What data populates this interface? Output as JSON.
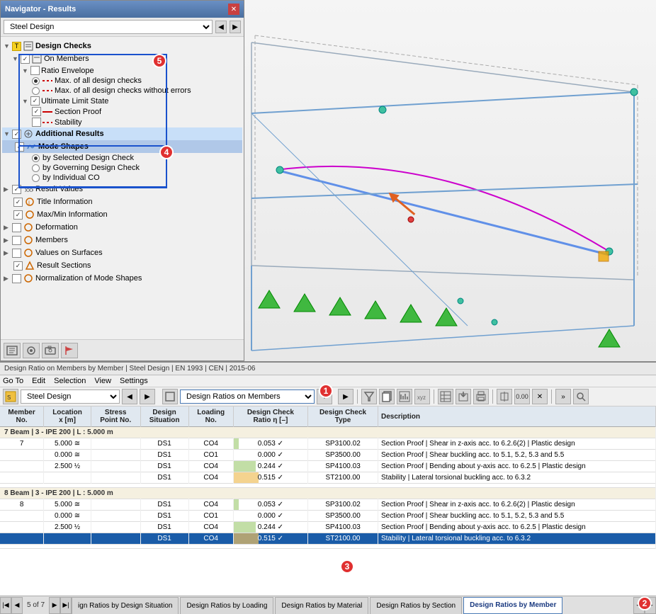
{
  "navigator": {
    "title": "Navigator - Results",
    "dropdown": "Steel Design",
    "tree": {
      "design_checks": "Design Checks",
      "on_members": "On Members",
      "ratio_envelope": "Ratio Envelope",
      "max_all": "Max. of all design checks",
      "max_all_no_errors": "Max. of all design checks without errors",
      "ultimate_limit": "Ultimate Limit State",
      "section_proof": "Section Proof",
      "stability": "Stability",
      "additional_results": "Additional Results",
      "mode_shapes": "Mode Shapes",
      "by_selected": "by Selected Design Check",
      "by_governing": "by Governing Design Check",
      "by_individual": "by Individual CO",
      "result_values": "Result Values",
      "title_info": "Title Information",
      "maxmin_info": "Max/Min Information",
      "deformation": "Deformation",
      "members": "Members",
      "values_on_surfaces": "Values on Surfaces",
      "result_sections": "Result Sections",
      "normalization": "Normalization of Mode Shapes"
    }
  },
  "results": {
    "title": "Design Ratio on Members by Member | Steel Design | EN 1993 | CEN | 2015-06",
    "menu": {
      "goto": "Go To",
      "edit": "Edit",
      "selection": "Selection",
      "view": "View",
      "settings": "Settings"
    },
    "toolbar": {
      "module_label": "Steel Design",
      "view_label": "Design Ratios on Members"
    },
    "table": {
      "headers": [
        "Member\nNo.",
        "Location\nx [m]",
        "Stress\nPoint No.",
        "Design\nSituation",
        "Loading\nNo.",
        "Design Check\nRatio η [–]",
        "Design Check\nType",
        "Description"
      ],
      "members": [
        {
          "id": 7,
          "label": "Beam | 3 - IPE 200 | L : 5.000 m",
          "rows": [
            {
              "location": "5.000",
              "loc_sym": "≅",
              "stress_pt": "",
              "situation": "DS1",
              "loading": "CO4",
              "ratio": 0.053,
              "ratio_pct": 10,
              "check_type": "SP3100.02",
              "description": "Section Proof | Shear in z-axis acc. to 6.2.6(2) | Plastic design",
              "ok": true
            },
            {
              "location": "0.000",
              "loc_sym": "≅",
              "stress_pt": "",
              "situation": "DS1",
              "loading": "CO1",
              "ratio": 0.0,
              "ratio_pct": 0,
              "check_type": "SP3500.00",
              "description": "Section Proof | Shear buckling acc. to 5.1, 5.2, 5.3 and 5.5",
              "ok": true
            },
            {
              "location": "2.500",
              "loc_sym": "½",
              "stress_pt": "",
              "situation": "DS1",
              "loading": "CO4",
              "ratio": 0.244,
              "ratio_pct": 44,
              "check_type": "SP4100.03",
              "description": "Section Proof | Bending about y-axis acc. to 6.2.5 | Plastic design",
              "ok": true
            },
            {
              "location": "",
              "loc_sym": "",
              "stress_pt": "",
              "situation": "DS1",
              "loading": "CO4",
              "ratio": 0.515,
              "ratio_pct": 51,
              "check_type": "ST2100.00",
              "description": "Stability | Lateral torsional buckling acc. to 6.3.2",
              "ok": true
            }
          ]
        },
        {
          "id": 8,
          "label": "Beam | 3 - IPE 200 | L : 5.000 m",
          "rows": [
            {
              "location": "5.000",
              "loc_sym": "≅",
              "stress_pt": "",
              "situation": "DS1",
              "loading": "CO4",
              "ratio": 0.053,
              "ratio_pct": 10,
              "check_type": "SP3100.02",
              "description": "Section Proof | Shear in z-axis acc. to 6.2.6(2) | Plastic design",
              "ok": true
            },
            {
              "location": "0.000",
              "loc_sym": "≅",
              "stress_pt": "",
              "situation": "DS1",
              "loading": "CO1",
              "ratio": 0.0,
              "ratio_pct": 0,
              "check_type": "SP3500.00",
              "description": "Section Proof | Shear buckling acc. to 5.1, 5.2, 5.3 and 5.5",
              "ok": true
            },
            {
              "location": "2.500",
              "loc_sym": "½",
              "stress_pt": "",
              "situation": "DS1",
              "loading": "CO4",
              "ratio": 0.244,
              "ratio_pct": 44,
              "check_type": "SP4100.03",
              "description": "Section Proof | Bending about y-axis acc. to 6.2.5 | Plastic design",
              "ok": true
            },
            {
              "location": "",
              "loc_sym": "",
              "stress_pt": "",
              "situation": "DS1",
              "loading": "CO4",
              "ratio": 0.515,
              "ratio_pct": 51,
              "check_type": "ST2100.00",
              "description": "Stability | Lateral torsional buckling acc. to 6.3.2",
              "ok": true,
              "highlighted": true
            }
          ]
        }
      ]
    },
    "bottom_tabs": [
      {
        "id": "by-situation",
        "label": "ign Ratios by Design Situation",
        "active": false
      },
      {
        "id": "by-loading",
        "label": "Design Ratios by Loading",
        "active": false
      },
      {
        "id": "by-material",
        "label": "Design Ratios by Material",
        "active": false
      },
      {
        "id": "by-section",
        "label": "Design Ratios by Section",
        "active": false
      },
      {
        "id": "by-member",
        "label": "Design Ratios by Member",
        "active": true
      }
    ],
    "page_info": "5 of 7"
  },
  "badges": {
    "badge1": "1",
    "badge2": "2",
    "badge3": "3",
    "badge4": "4",
    "badge5": "5"
  },
  "icons": {
    "close": "✕",
    "prev": "◀",
    "next": "▶",
    "arrow_left": "◄",
    "arrow_right": "►",
    "eye": "👁",
    "camera": "📷"
  }
}
